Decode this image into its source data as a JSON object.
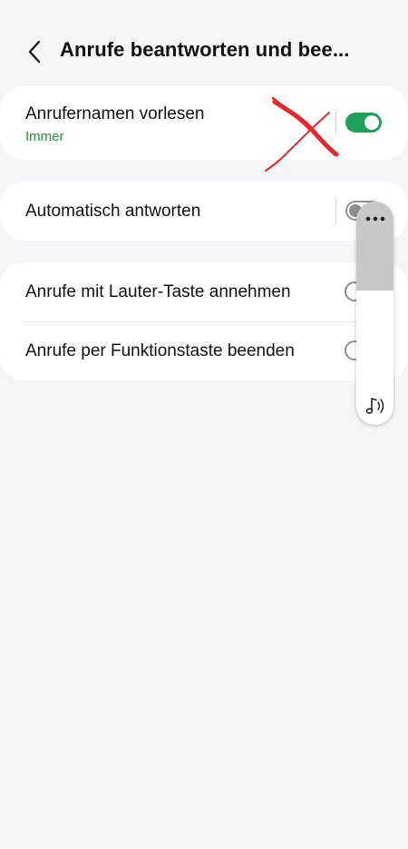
{
  "header": {
    "title": "Anrufe beantworten und bee..."
  },
  "settings": {
    "read_caller_names": {
      "label": "Anrufernamen vorlesen",
      "value": "Immer",
      "enabled": true
    },
    "auto_answer": {
      "label": "Automatisch antworten",
      "enabled": false
    },
    "volume_key_answer": {
      "label": "Anrufe mit Lauter-Taste annehmen",
      "enabled": false
    },
    "side_key_end": {
      "label": "Anrufe per Funktionstaste beenden",
      "enabled": false
    }
  },
  "volume_panel": {
    "level": 0.4,
    "icon": "music-note-icon"
  },
  "colors": {
    "accent": "#21a05a",
    "subtext": "#2a8a3c",
    "annotation": "#e8262d",
    "background": "#f5f5f7"
  }
}
